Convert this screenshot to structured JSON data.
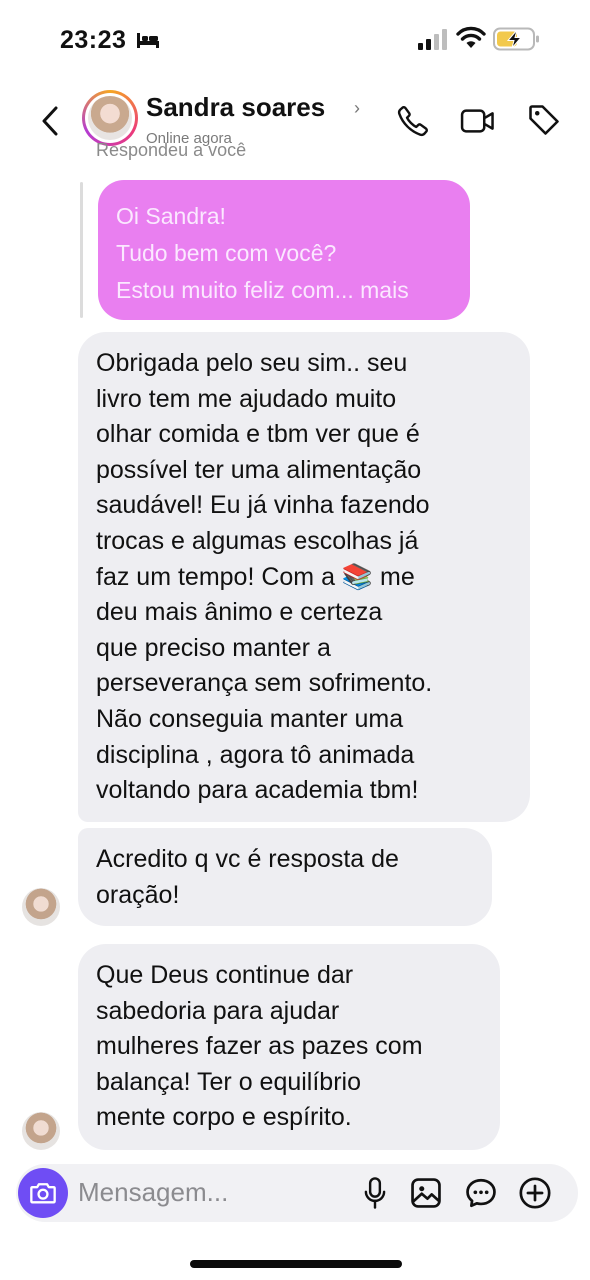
{
  "status_bar": {
    "time": "23:23",
    "icons": [
      "bed-icon",
      "signal-icon",
      "wifi-icon",
      "battery-charging-icon"
    ]
  },
  "header": {
    "contact_name": "Sandra soares",
    "contact_status": "Online agora",
    "icons": [
      "back-icon",
      "phone-icon",
      "video-icon",
      "tag-icon"
    ]
  },
  "chat": {
    "replied_label": "Respondeu a você",
    "quoted_message": {
      "lines": [
        "Oi Sandra!",
        "Tudo bem com você?",
        "Estou muito feliz com... mais"
      ]
    },
    "messages": [
      {
        "lines": [
          "Obrigada  pelo seu sim..   seu",
          "livro  tem me ajudado  muito",
          "olhar  comida e  tbm ver  que é",
          "possível  ter uma alimentação",
          "saudável! Eu já vinha fazendo",
          "trocas  e algumas  escolhas  já",
          "faz um tempo! Com a 📚 me",
          "deu mais ânimo   e certeza",
          "que preciso  manter a",
          "perseverança  sem sofrimento.",
          "Não conseguia manter uma",
          "disciplina , agora tô animada",
          "voltando para academia  tbm!"
        ]
      },
      {
        "lines": [
          "Acredito  q vc  é resposta  de",
          "oração!"
        ]
      },
      {
        "lines": [
          "Que  Deus  continue  dar",
          "sabedoria  para ajudar",
          "mulheres  fazer as pazes com",
          "balança! Ter o equilíbrio",
          "mente corpo e espírito."
        ]
      }
    ]
  },
  "composer": {
    "placeholder": "Mensagem...",
    "icons": [
      "camera-icon",
      "microphone-icon",
      "gallery-icon",
      "sticker-icon",
      "plus-icon"
    ]
  },
  "colors": {
    "quoted_bubble": "#e97ff0",
    "incoming_bubble": "#eeeef2",
    "camera_button": "#6f4df4"
  }
}
